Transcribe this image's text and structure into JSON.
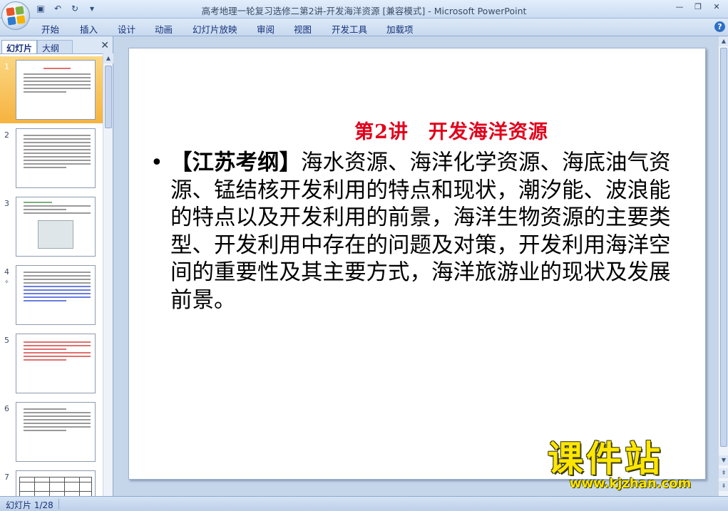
{
  "window": {
    "title": "高考地理一轮复习选修二第2讲-开发海洋资源 [兼容模式] - Microsoft PowerPoint"
  },
  "ribbon": {
    "tabs": [
      "开始",
      "插入",
      "设计",
      "动画",
      "幻灯片放映",
      "审阅",
      "视图",
      "开发工具",
      "加载项"
    ]
  },
  "pane": {
    "tab_slides": "幻灯片",
    "tab_outline": "大纲",
    "thumbnails": [
      {
        "num": "1"
      },
      {
        "num": "2"
      },
      {
        "num": "3"
      },
      {
        "num": "4"
      },
      {
        "num": "5"
      },
      {
        "num": "6"
      },
      {
        "num": "7"
      }
    ]
  },
  "slide": {
    "title": "第2讲　开发海洋资源",
    "bullet": "•",
    "keyword": "【江苏考纲】",
    "body": "海水资源、海洋化学资源、海底油气资源、锰结核开发利用的特点和现状，潮汐能、波浪能的特点以及开发利用的前景，海洋生物资源的主要类型、开发利用中存在的问题及对策，开发利用海洋空间的重要性及其主要方式，海洋旅游业的现状及发展前景。"
  },
  "watermark": {
    "brand": "课件站",
    "url": "www.kjzhan.com"
  },
  "status": {
    "slide_counter": "幻灯片 1/28"
  },
  "colors": {
    "title_red": "#e0001b",
    "watermark_yellow": "#ffe600",
    "selection_orange": "#f6b33f"
  }
}
